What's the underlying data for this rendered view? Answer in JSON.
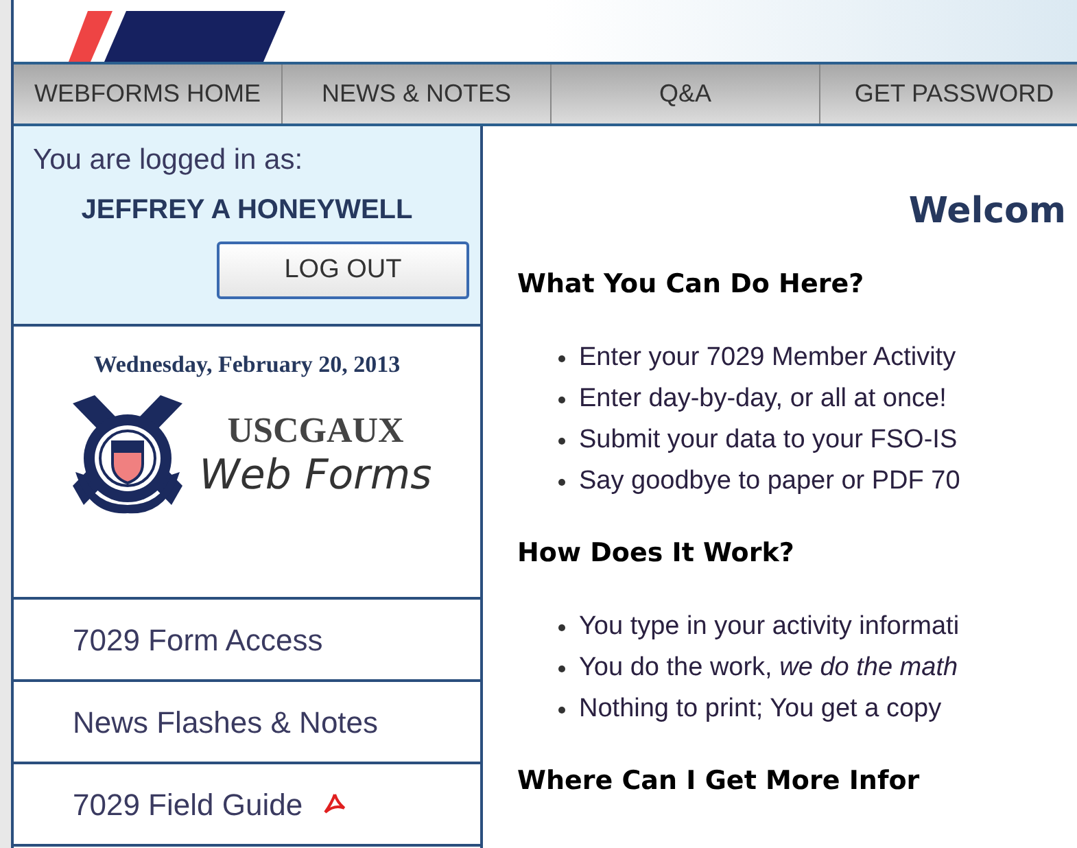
{
  "nav": [
    {
      "label": "WEBFORMS HOME"
    },
    {
      "label": "NEWS & NOTES"
    },
    {
      "label": "Q&A"
    },
    {
      "label": "GET PASSWORD"
    }
  ],
  "login": {
    "caption": "You are logged in as:",
    "user": "JEFFREY A HONEYWELL",
    "button": "LOG OUT"
  },
  "date": "Wednesday, February 20, 2013",
  "logo": {
    "title": "USCGAUX",
    "subtitle": "Web Forms"
  },
  "sidebar_links": [
    {
      "label": "7029 Form Access",
      "pdf": false
    },
    {
      "label": "News Flashes & Notes",
      "pdf": false
    },
    {
      "label": "7029 Field Guide",
      "pdf": true
    }
  ],
  "welcome": "Welcom",
  "sections": [
    {
      "heading": "What You Can Do Here?",
      "items": [
        "Enter your 7029 Member Activity",
        "Enter day-by-day, or all at once!",
        "Submit your data to your FSO-IS",
        "Say goodbye to paper or PDF 70"
      ]
    },
    {
      "heading": "How Does It Work?",
      "items": [
        "You type in your activity informati",
        "You do the work, *we do the math*",
        "Nothing to print; You get a copy"
      ]
    },
    {
      "heading": "Where Can I Get More Infor"
    }
  ]
}
